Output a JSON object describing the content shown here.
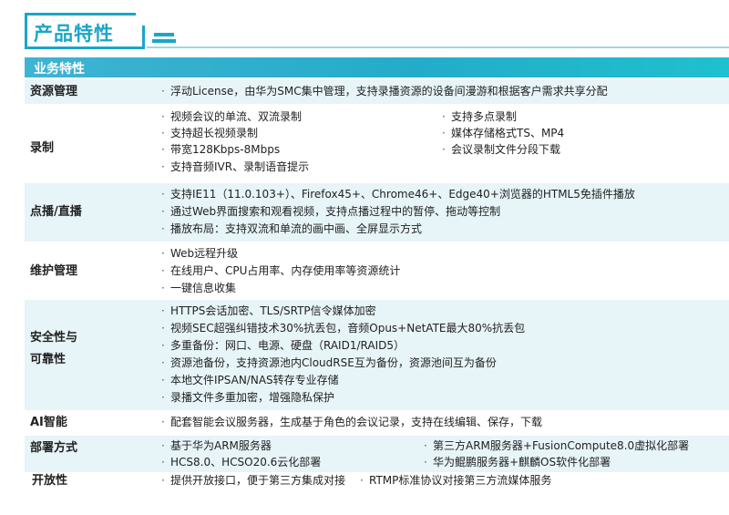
{
  "page_title": "产品特性",
  "section_header": "业务特性",
  "rows": [
    {
      "label": "资源管理",
      "items": [
        "浮动License，由华为SMC集中管理，支持录播资源的设备间漫游和根据客户需求共享分配"
      ]
    },
    {
      "label": "录制",
      "items_left": [
        "视频会议的单流、双流录制",
        "支持超长视频录制",
        "带宽128Kbps-8Mbps",
        "支持音频IVR、录制语音提示"
      ],
      "items_right": [
        "支持多点录制",
        "媒体存储格式TS、MP4",
        "会议录制文件分段下载"
      ]
    },
    {
      "label": "点播/直播",
      "items": [
        "支持IE11（11.0.103+）、Firefox45+、Chrome46+、Edge40+浏览器的HTML5免插件播放",
        "通过Web界面搜索和观看视频，支持点播过程中的暂停、拖动等控制",
        "播放布局：支持双流和单流的画中画、全屏显示方式"
      ]
    },
    {
      "label": "维护管理",
      "items": [
        "Web远程升级",
        "在线用户、CPU占用率、内存使用率等资源统计",
        "一键信息收集"
      ]
    },
    {
      "label_line1": "安全性与",
      "label_line2": "可靠性",
      "items": [
        "HTTPS会话加密、TLS/SRTP信令媒体加密",
        "视频SEC超强纠错技术30%抗丢包，音频Opus+NetATE最大80%抗丢包",
        "多重备份：网口、电源、硬盘（RAID1/RAID5）",
        "资源池备份，支持资源池内CloudRSE互为备份，资源池间互为备份",
        "本地文件IPSAN/NAS转存专业存储",
        "录播文件多重加密，增强隐私保护"
      ]
    },
    {
      "label": "AI智能",
      "items": [
        "配套智能会议服务器，生成基于角色的会议记录，支持在线编辑、保存，下载"
      ]
    },
    {
      "label": "部署方式",
      "items_left": [
        "基于华为ARM服务器",
        "HCS8.0、HCSO20.6云化部署"
      ],
      "items_right": [
        "第三方ARM服务器+FusionCompute8.0虚拟化部署",
        "华为鲲鹏服务器+麒麟OS软件化部署"
      ]
    },
    {
      "label": "开放性",
      "items": [
        "提供开放接口，便于第三方集成对接",
        "RTMP标准协议对接第三方流媒体服务"
      ]
    }
  ],
  "bullet_char": "·"
}
